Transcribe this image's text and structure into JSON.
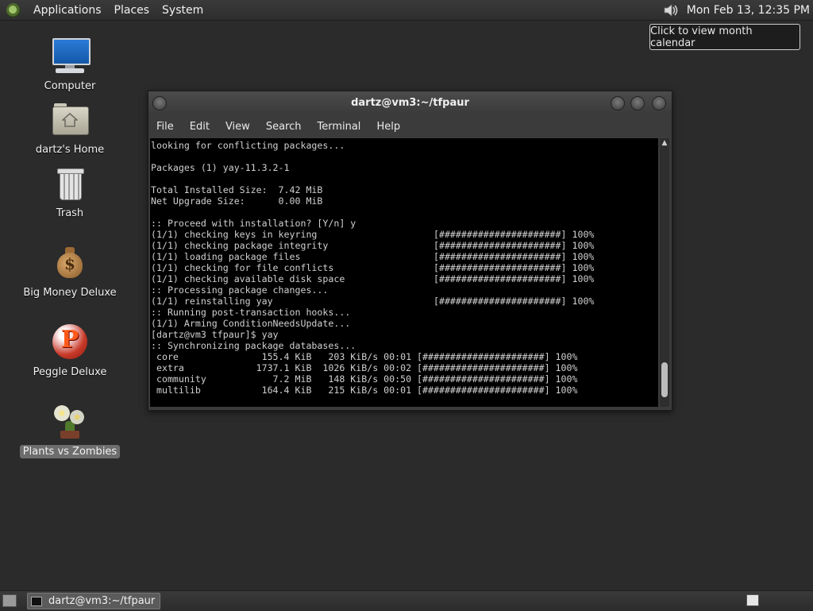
{
  "top_panel": {
    "menus": [
      "Applications",
      "Places",
      "System"
    ],
    "clock": "Mon Feb 13, 12:35 PM"
  },
  "tooltip": "Click to view month calendar",
  "desktop_icons": [
    {
      "label": "Computer",
      "icon": "computer-icon"
    },
    {
      "label": "dartz's Home",
      "icon": "home-folder-icon"
    },
    {
      "label": "Trash",
      "icon": "trash-icon"
    },
    {
      "label": "Big Money Deluxe",
      "icon": "money-bag-icon"
    },
    {
      "label": "Peggle Deluxe",
      "icon": "peggle-icon"
    },
    {
      "label": "Plants vs Zombies",
      "icon": "plants-vs-zombies-icon",
      "selected": true
    }
  ],
  "terminal": {
    "title": "dartz@vm3:~/tfpaur",
    "menu": [
      "File",
      "Edit",
      "View",
      "Search",
      "Terminal",
      "Help"
    ],
    "lines": [
      "looking for conflicting packages...",
      "",
      "Packages (1) yay-11.3.2-1",
      "",
      "Total Installed Size:  7.42 MiB",
      "Net Upgrade Size:      0.00 MiB",
      "",
      ":: Proceed with installation? [Y/n] y",
      "(1/1) checking keys in keyring                     [######################] 100%",
      "(1/1) checking package integrity                   [######################] 100%",
      "(1/1) loading package files                        [######################] 100%",
      "(1/1) checking for file conflicts                  [######################] 100%",
      "(1/1) checking available disk space                [######################] 100%",
      ":: Processing package changes...",
      "(1/1) reinstalling yay                             [######################] 100%",
      ":: Running post-transaction hooks...",
      "(1/1) Arming ConditionNeedsUpdate...",
      "[dartz@vm3 tfpaur]$ yay",
      ":: Synchronizing package databases...",
      " core               155.4 KiB   203 KiB/s 00:01 [######################] 100%",
      " extra             1737.1 KiB  1026 KiB/s 00:02 [######################] 100%",
      " community            7.2 MiB   148 KiB/s 00:50 [######################] 100%",
      " multilib           164.4 KiB   215 KiB/s 00:01 [######################] 100%"
    ]
  },
  "taskbar": {
    "window_button": "dartz@vm3:~/tfpaur"
  }
}
